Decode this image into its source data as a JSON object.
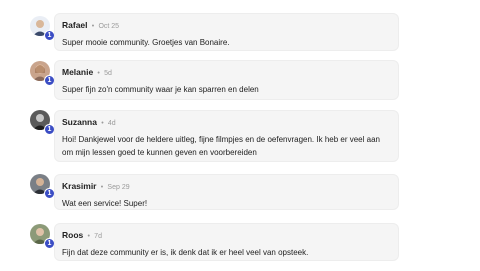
{
  "comments": [
    {
      "author": "Rafael",
      "separator": "•",
      "time": "Oct 25",
      "text": "Super mooie community. Groetjes van Bonaire.",
      "level": "1",
      "avatar_color": "#3b4a6b"
    },
    {
      "author": "Melanie",
      "separator": "•",
      "time": "5d",
      "text": "Super fijn zo'n community waar je kan sparren en delen",
      "level": "1",
      "avatar_color": "#b88a6e"
    },
    {
      "author": "Suzanna",
      "separator": "•",
      "time": "4d",
      "text": "Hoi! Dankjewel voor de heldere uitleg, fijne filmpjes en de oefenvragen. Ik heb er veel aan om mijn lessen goed te kunnen geven en voorbereiden",
      "level": "1",
      "avatar_color": "#2e2e2e"
    },
    {
      "author": "Krasimir",
      "separator": "•",
      "time": "Sep 29",
      "text": "Wat een service! Super!",
      "level": "1",
      "avatar_color": "#4a4a52"
    },
    {
      "author": "Roos",
      "separator": "•",
      "time": "7d",
      "text": "Fijn dat deze community er is, ik denk dat ik er heel veel van opsteek.",
      "level": "1",
      "avatar_color": "#6d7a5a"
    }
  ],
  "colors": {
    "bubble_bg": "#f5f5f5",
    "level_badge": "#3b4dc4",
    "muted_text": "#9a9a9a"
  }
}
